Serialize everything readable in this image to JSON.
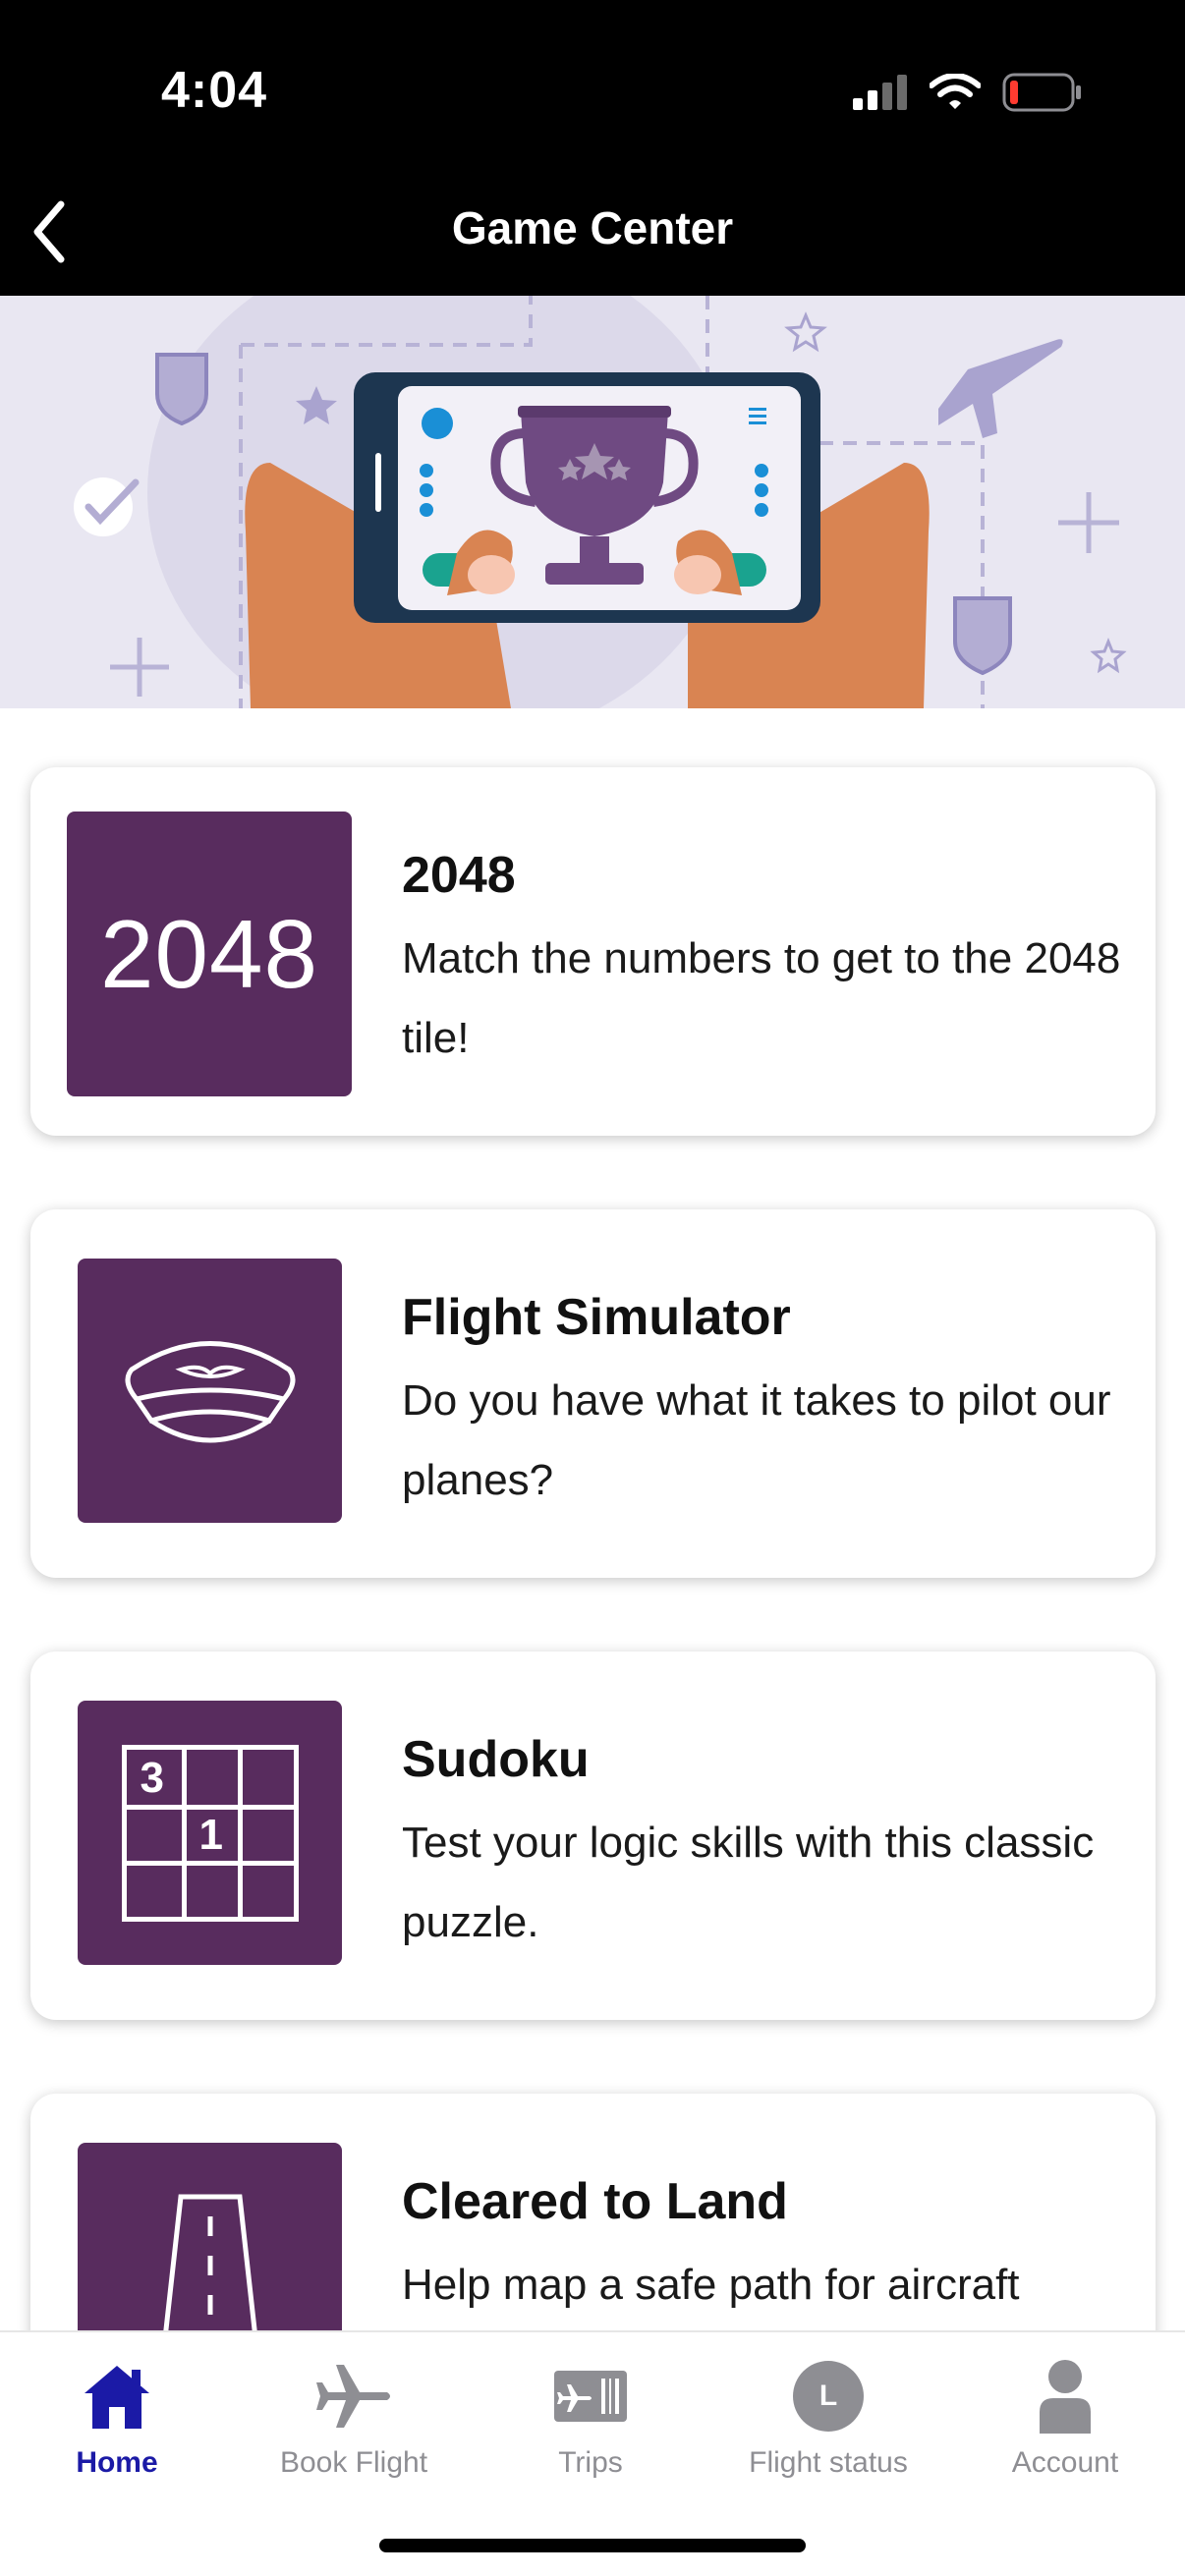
{
  "status_bar": {
    "time": "4:04"
  },
  "header": {
    "title": "Game Center"
  },
  "games": [
    {
      "title": "2048",
      "description": "Match the numbers to get to the 2048 tile!",
      "tile_text": "2048"
    },
    {
      "title": "Flight Simulator",
      "description": "Do you have what it takes to pilot our planes?"
    },
    {
      "title": "Sudoku",
      "description": "Test your logic skills with this classic puzzle.",
      "grid_digits": [
        "3",
        "1"
      ]
    },
    {
      "title": "Cleared to Land",
      "description": "Help map a safe path for aircraft"
    }
  ],
  "bottom_nav": {
    "items": [
      {
        "label": "Home",
        "icon": "home-icon",
        "active": true
      },
      {
        "label": "Book Flight",
        "icon": "plane-icon"
      },
      {
        "label": "Trips",
        "icon": "ticket-icon"
      },
      {
        "label": "Flight status",
        "icon": "clock-icon",
        "badge": "L"
      },
      {
        "label": "Account",
        "icon": "person-icon"
      }
    ]
  },
  "colors": {
    "brand_purple": "#582c5e",
    "active_nav": "#1b1aa6",
    "banner_bg": "#e9e7f2"
  }
}
